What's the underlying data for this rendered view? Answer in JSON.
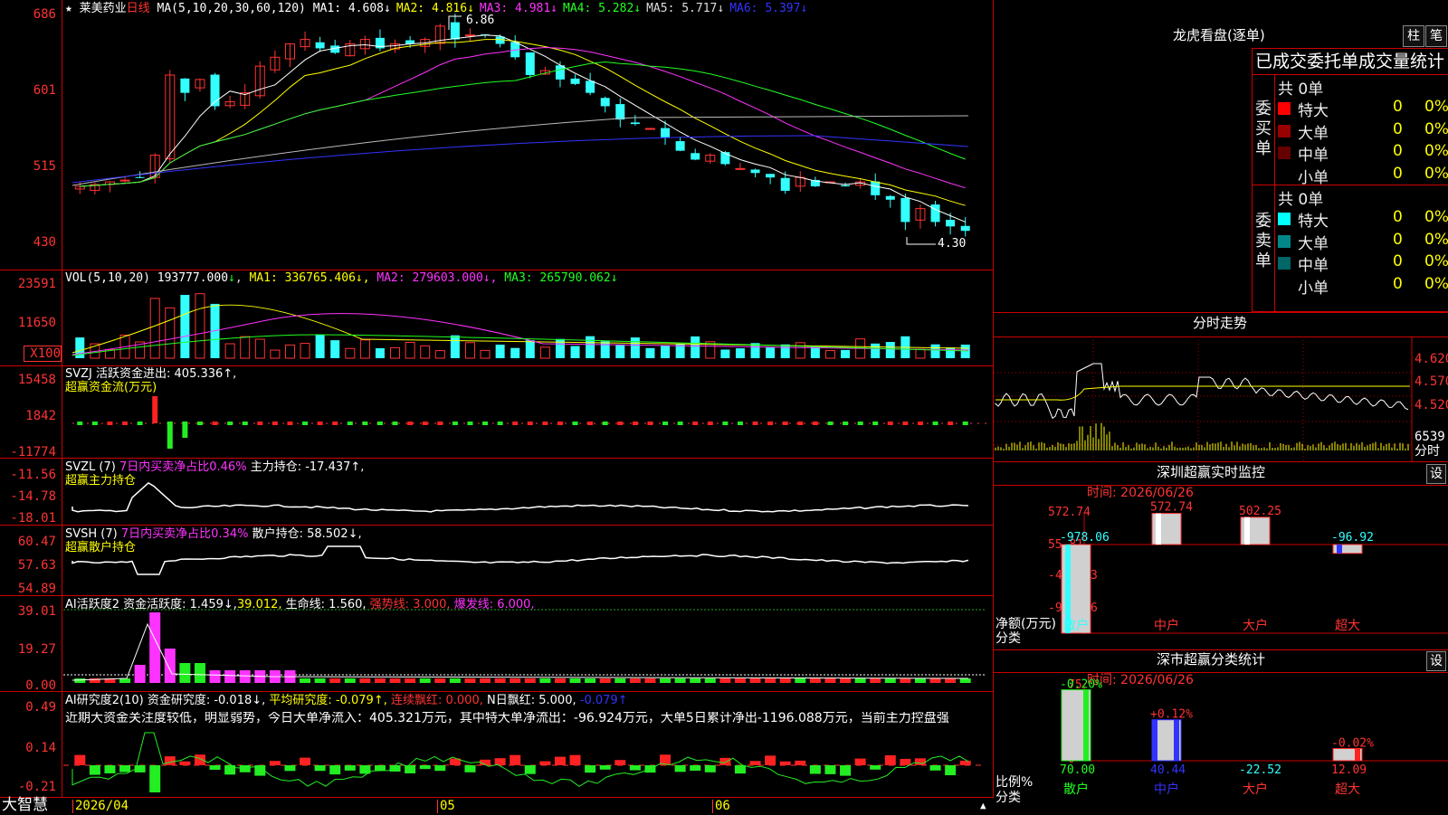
{
  "stock": {
    "star": "★",
    "name": "莱美药业",
    "period": "日线"
  },
  "ma_header": {
    "prefix": "MA(5,10,20,30,60,120)",
    "items": [
      {
        "label": "MA1:",
        "value": "4.608",
        "arrow": "↓",
        "color": "#ffffff"
      },
      {
        "label": "MA2:",
        "value": "4.816",
        "arrow": "↓",
        "color": "#ffff00"
      },
      {
        "label": "MA3:",
        "value": "4.981",
        "arrow": "↓",
        "color": "#ff33ff"
      },
      {
        "label": "MA4:",
        "value": "5.282",
        "arrow": "↓",
        "color": "#22ff22"
      },
      {
        "label": "MA5:",
        "value": "5.717",
        "arrow": "↓",
        "color": "#dddddd"
      },
      {
        "label": "MA6:",
        "value": "5.397",
        "arrow": "↓",
        "color": "#3333ff"
      }
    ]
  },
  "price_axis": [
    "686",
    "601",
    "515",
    "430"
  ],
  "price_marks": {
    "high": "6.86",
    "low": "4.30"
  },
  "vol_header": {
    "prefix": "VOL(5,10,20)",
    "value": "193777.000",
    "arrow": "↓",
    "ma1": "MA1: 336765.406↓,",
    "ma2": "MA2: 279603.000↓,",
    "ma3": "MA3: 265790.062↓"
  },
  "vol_axis": [
    "23591",
    "11650",
    "X100"
  ],
  "svzj": {
    "title": "SVZJ  活跃资金进出: 405.336↑,",
    "subtitle": "超赢资金流(万元)",
    "axis": [
      "15458",
      "1842",
      "-11774"
    ]
  },
  "svzl": {
    "prefix": "SVZL (7)",
    "pct": "7日内买卖净占比0.46%",
    "main": "主力持仓: -17.437↑,",
    "subtitle": "超赢主力持仓",
    "axis": [
      "-11.56",
      "-14.78",
      "-18.01"
    ]
  },
  "svsh": {
    "prefix": "SVSH (7)",
    "pct": "7日内买卖净占比0.34%",
    "main": "散户持仓: 58.502↓,",
    "subtitle": "超赢散户持仓",
    "axis": [
      "60.47",
      "57.63",
      "54.89"
    ]
  },
  "ai_active": {
    "title": "AI活跃度2 资金活跃度: 1.459↓,",
    "v2": "39.012,",
    "life": "生命线: 1.560,",
    "strong": "强势线: 3.000,",
    "burst": "爆发线: 6.000,",
    "axis": [
      "39.01",
      "19.27",
      "0.00"
    ]
  },
  "ai_research": {
    "title": "AI研究度2(10) 资金研究度: -0.018↓,",
    "avg": "平均研究度: -0.079↑,",
    "cont": "连续飘红: 0.000,",
    "nday": "N日飘红: 5.000,",
    "last": "-0.079↑",
    "comment": "近期大资金关注度较低，明显弱势，今日大单净流入：405.321万元，其中特大单净流出：-96.924万元，大单5日累计净出-1196.088万元，当前主力控盘强",
    "axis": [
      "0.49",
      "0.14",
      "-0.21"
    ]
  },
  "bottom_bar": {
    "brand": "大智慧",
    "dates": [
      "2026/04",
      "05",
      "06"
    ]
  },
  "dragon": {
    "title": "龙虎看盘(逐单)",
    "btn1": "柱",
    "btn2": "笔",
    "subtitle": "已成交委托单成交量统计",
    "buy": {
      "label": "委买单",
      "total": "共 0单",
      "rows": [
        {
          "name": "特大",
          "val": "0",
          "pct": "0%",
          "color": "#ff0000"
        },
        {
          "name": "大单",
          "val": "0",
          "pct": "0%",
          "color": "#990000"
        },
        {
          "name": "中单",
          "val": "0",
          "pct": "0%",
          "color": "#660000"
        },
        {
          "name": "小单",
          "val": "0",
          "pct": "0%",
          "color": "#000000"
        }
      ]
    },
    "sell": {
      "label": "委卖单",
      "total": "共 0单",
      "rows": [
        {
          "name": "特大",
          "val": "0",
          "pct": "0%",
          "color": "#00ffff"
        },
        {
          "name": "大单",
          "val": "0",
          "pct": "0%",
          "color": "#008888"
        },
        {
          "name": "中单",
          "val": "0",
          "pct": "0%",
          "color": "#006666"
        },
        {
          "name": "小单",
          "val": "0",
          "pct": "0%",
          "color": "#000000"
        }
      ]
    }
  },
  "intraday": {
    "title": "分时走势",
    "axis": [
      "4.620",
      "4.570",
      "4.520"
    ],
    "vol": "6539",
    "unit": "分时"
  },
  "monitor": {
    "title": "深圳超赢实时监控",
    "btn": "设",
    "time": "时间: 2026/06/26",
    "axis": [
      "572.74",
      "55.81",
      "-461.13",
      "-978.06"
    ],
    "ylabel": "净额(万元)",
    "xlabel": "分类",
    "bars": [
      {
        "cat": "散户",
        "value": "-978.06"
      },
      {
        "cat": "中户",
        "value": "572.74"
      },
      {
        "cat": "大户",
        "value": "502.25"
      },
      {
        "cat": "超大",
        "value": "-96.92"
      }
    ]
  },
  "classify": {
    "title": "深市超赢分类统计",
    "btn": "设",
    "time": "时间: 2026/06/26",
    "axis": [
      "75",
      "50",
      "25",
      "0"
    ],
    "ylabel": "比例%",
    "xlabel": "分类",
    "bars": [
      {
        "cat": "散户",
        "pct": "-0.20%",
        "value": "70.00"
      },
      {
        "cat": "中户",
        "pct": "+0.12%",
        "value": "40.44"
      },
      {
        "cat": "大户",
        "pct": "",
        "value": "-22.52"
      },
      {
        "cat": "超大",
        "pct": "-0.02%",
        "value": "12.09"
      }
    ]
  }
}
